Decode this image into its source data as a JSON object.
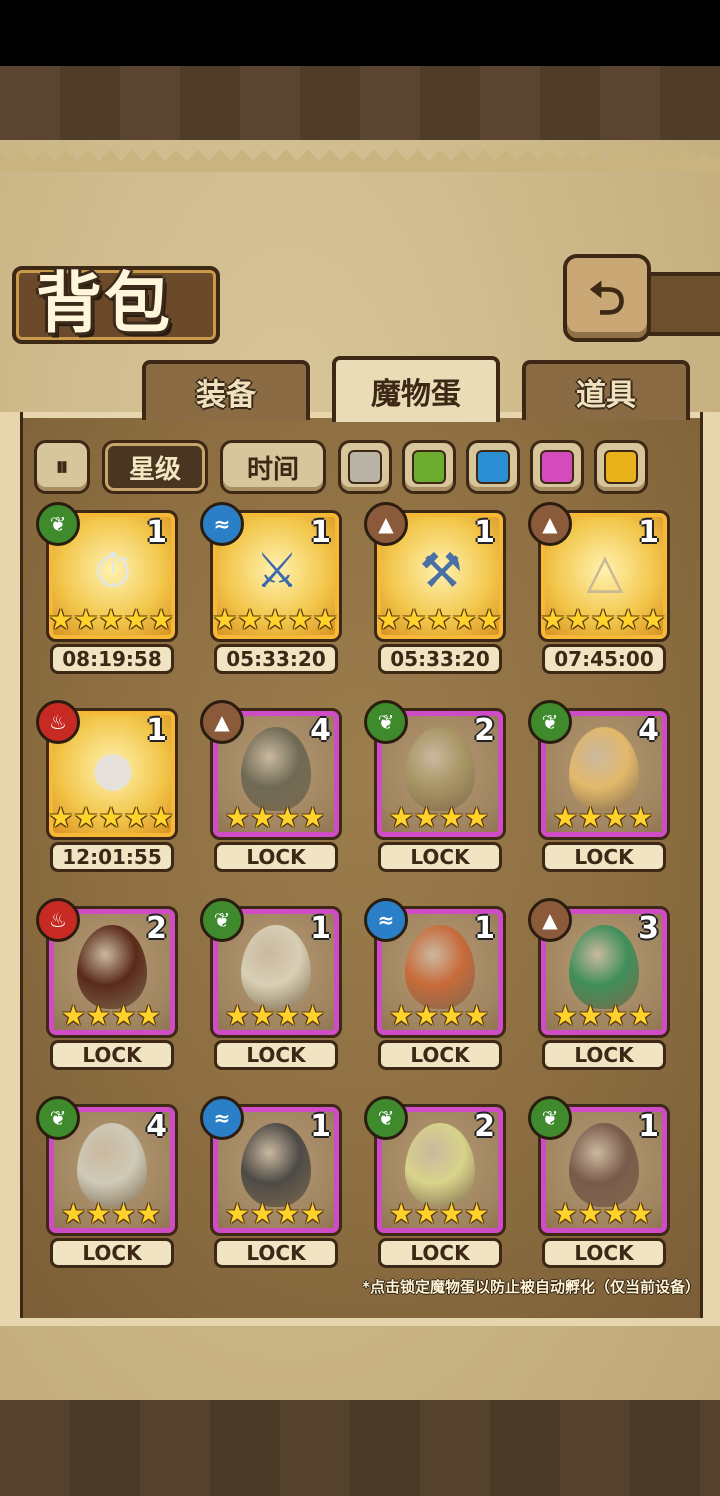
{
  "screen": {
    "title": "背包",
    "back_icon": "back-arrow-icon"
  },
  "tabs": [
    {
      "label": "装备",
      "active": false
    },
    {
      "label": "魔物蛋",
      "active": true
    },
    {
      "label": "道具",
      "active": false
    }
  ],
  "filters": {
    "pause_icon": "pause-icon",
    "sort_star": "星级",
    "sort_time": "时间",
    "rarity_swatches": [
      {
        "name": "gray",
        "color": "#b9b3a6"
      },
      {
        "name": "green",
        "color": "#6cac2e"
      },
      {
        "name": "blue",
        "color": "#2d8fd3"
      },
      {
        "name": "pink",
        "color": "#d64bbb"
      },
      {
        "name": "yellow",
        "color": "#e9b21a"
      }
    ]
  },
  "items": [
    {
      "element": "grass",
      "count": "1",
      "stars": 5,
      "rarity": "gold",
      "label": "08:19:58",
      "icon": "pocket-watch-icon"
    },
    {
      "element": "water",
      "count": "1",
      "stars": 5,
      "rarity": "gold",
      "label": "05:33:20",
      "icon": "sword-icon"
    },
    {
      "element": "earth",
      "count": "1",
      "stars": 5,
      "rarity": "gold",
      "label": "05:33:20",
      "icon": "hammer-icon"
    },
    {
      "element": "earth",
      "count": "1",
      "stars": 5,
      "rarity": "gold",
      "label": "07:45:00",
      "icon": "pyramid-icon"
    },
    {
      "element": "fire",
      "count": "1",
      "stars": 5,
      "rarity": "gold",
      "label": "12:01:55",
      "icon": "fire-egg-icon"
    },
    {
      "element": "earth",
      "count": "4",
      "stars": 4,
      "rarity": "purple",
      "label": "LOCK",
      "icon": "beetle-egg-icon"
    },
    {
      "element": "grass",
      "count": "2",
      "stars": 4,
      "rarity": "purple",
      "label": "LOCK",
      "icon": "leaf-egg-icon"
    },
    {
      "element": "grass",
      "count": "4",
      "stars": 4,
      "rarity": "purple",
      "label": "LOCK",
      "icon": "heart-egg-icon"
    },
    {
      "element": "fire",
      "count": "2",
      "stars": 4,
      "rarity": "purple",
      "label": "LOCK",
      "icon": "lava-egg-icon"
    },
    {
      "element": "grass",
      "count": "1",
      "stars": 4,
      "rarity": "purple",
      "label": "LOCK",
      "icon": "bone-egg-icon"
    },
    {
      "element": "water",
      "count": "1",
      "stars": 4,
      "rarity": "purple",
      "label": "LOCK",
      "icon": "feather-egg-icon"
    },
    {
      "element": "earth",
      "count": "3",
      "stars": 4,
      "rarity": "purple",
      "label": "LOCK",
      "icon": "jade-egg-icon"
    },
    {
      "element": "grass",
      "count": "4",
      "stars": 4,
      "rarity": "purple",
      "label": "LOCK",
      "icon": "shell-egg-icon"
    },
    {
      "element": "water",
      "count": "1",
      "stars": 4,
      "rarity": "purple",
      "label": "LOCK",
      "icon": "armor-egg-icon"
    },
    {
      "element": "grass",
      "count": "2",
      "stars": 4,
      "rarity": "purple",
      "label": "LOCK",
      "icon": "sprout-egg-icon"
    },
    {
      "element": "grass",
      "count": "1",
      "stars": 4,
      "rarity": "purple",
      "label": "LOCK",
      "icon": "moth-egg-icon"
    }
  ],
  "footnote": "*点击锁定魔物蛋以防止被自动孵化（仅当前设备）"
}
